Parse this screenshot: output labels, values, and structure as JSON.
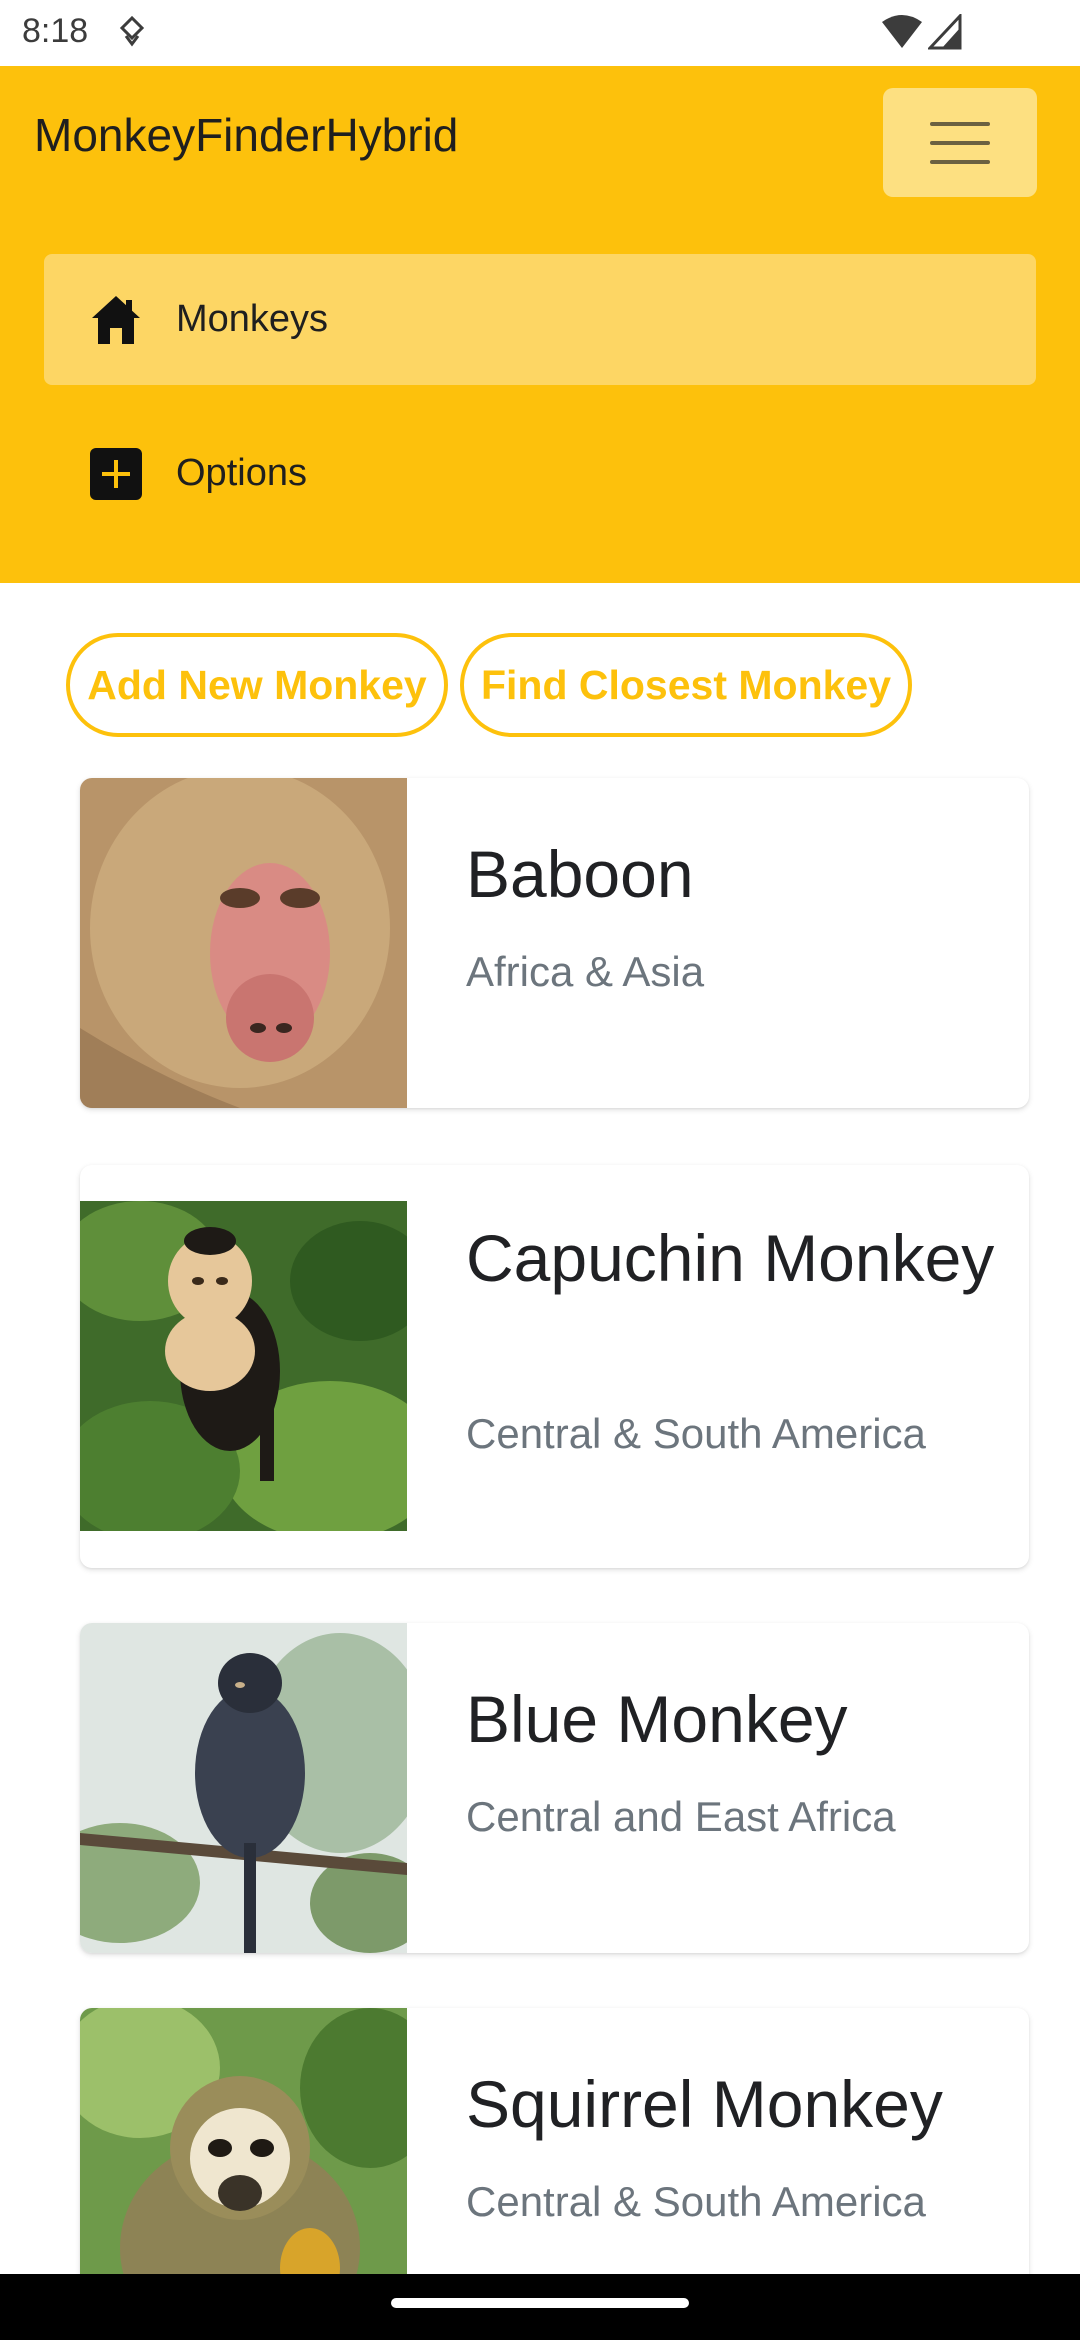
{
  "status": {
    "time": "8:18"
  },
  "header": {
    "brand": "MonkeyFinderHybrid",
    "nav": [
      {
        "label": "Monkeys",
        "icon": "home-icon",
        "active": true
      },
      {
        "label": "Options",
        "icon": "plus-square-icon",
        "active": false
      }
    ]
  },
  "actions": {
    "add_label": "Add New Monkey",
    "find_label": "Find Closest Monkey"
  },
  "monkeys": [
    {
      "name": "Baboon",
      "location": "Africa & Asia"
    },
    {
      "name": "Capuchin Monkey",
      "location": "Central & South America"
    },
    {
      "name": "Blue Monkey",
      "location": "Central and East Africa"
    },
    {
      "name": "Squirrel Monkey",
      "location": "Central & South America"
    }
  ],
  "colors": {
    "accent": "#fdc10c",
    "accent_light": "#fdd664",
    "muted_text": "#6c757d"
  }
}
